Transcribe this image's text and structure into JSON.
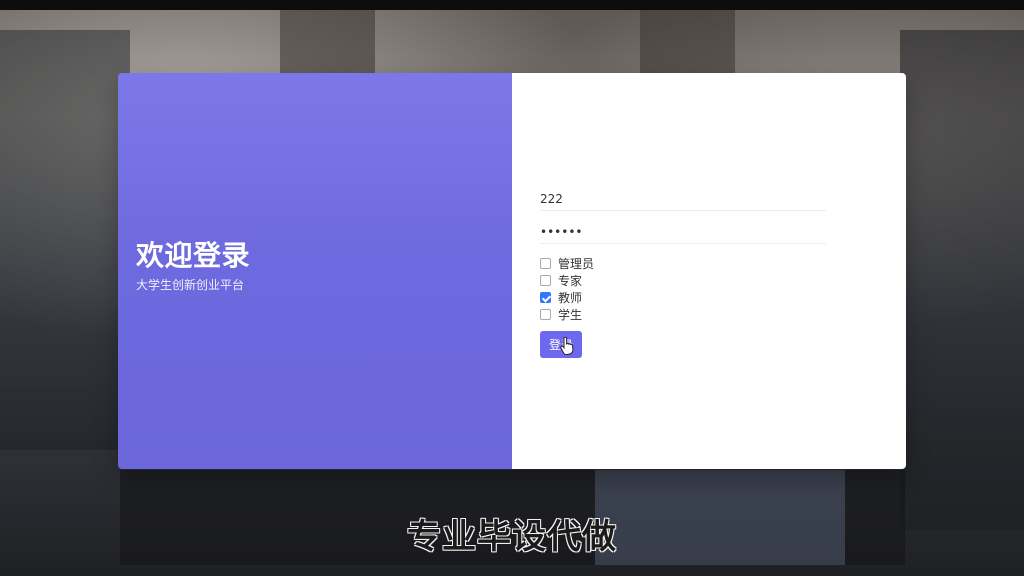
{
  "hero": {
    "title": "欢迎登录",
    "subtitle": "大学生创新创业平台"
  },
  "login": {
    "username_value": "222",
    "password_value": "••••••",
    "roles": [
      {
        "label": "管理员",
        "checked": false
      },
      {
        "label": "专家",
        "checked": false
      },
      {
        "label": "教师",
        "checked": true
      },
      {
        "label": "学生",
        "checked": false
      }
    ],
    "button_label": "登录"
  },
  "caption": {
    "text": "专业毕设代做"
  },
  "theme": {
    "accent": "#6e68ef",
    "hero": "#6d69de",
    "panel": "#ffffff",
    "checkbox_selected": "#2f78ff"
  },
  "icons": {
    "cursor": "pointer-hand-icon"
  }
}
